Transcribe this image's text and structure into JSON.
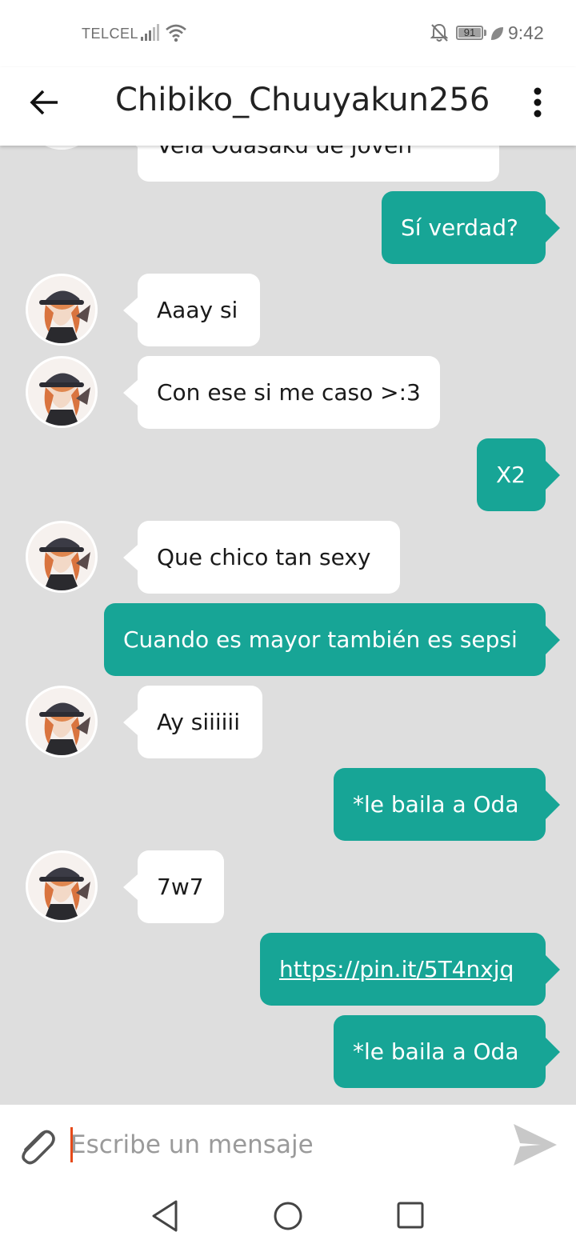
{
  "status_bar": {
    "carrier": "TELCEL",
    "battery": "91",
    "time": "9:42"
  },
  "header": {
    "title": "Chibiko_Chuuyakun256"
  },
  "messages": [
    {
      "dir": "in",
      "text": "Veía Odasaku de joven",
      "avatar": false
    },
    {
      "dir": "out",
      "text": "Sí verdad?"
    },
    {
      "dir": "in",
      "text": "Aaay si",
      "avatar": true
    },
    {
      "dir": "in",
      "text": "Con ese si me caso >:3",
      "avatar": true
    },
    {
      "dir": "out",
      "text": "X2"
    },
    {
      "dir": "in",
      "text": "Que chico tan sexy",
      "avatar": true
    },
    {
      "dir": "out",
      "text": "Cuando es mayor también es sepsi"
    },
    {
      "dir": "in",
      "text": "Ay siiiiii",
      "avatar": true
    },
    {
      "dir": "out",
      "text": "*le baila a Oda"
    },
    {
      "dir": "in",
      "text": "7w7",
      "avatar": true
    },
    {
      "dir": "out",
      "text": "https://pin.it/5T4nxjq",
      "link": true
    },
    {
      "dir": "out",
      "text": "*le baila a Oda"
    }
  ],
  "composer": {
    "placeholder": "Escribe un mensaje"
  },
  "colors": {
    "outgoing_bubble": "#17a596",
    "incoming_bubble": "#ffffff",
    "chat_background": "#dedede",
    "caret": "#e64a19"
  },
  "icons": [
    "back-arrow-icon",
    "more-vert-icon",
    "attach-icon",
    "send-icon",
    "nav-back-icon",
    "nav-home-icon",
    "nav-recents-icon"
  ]
}
